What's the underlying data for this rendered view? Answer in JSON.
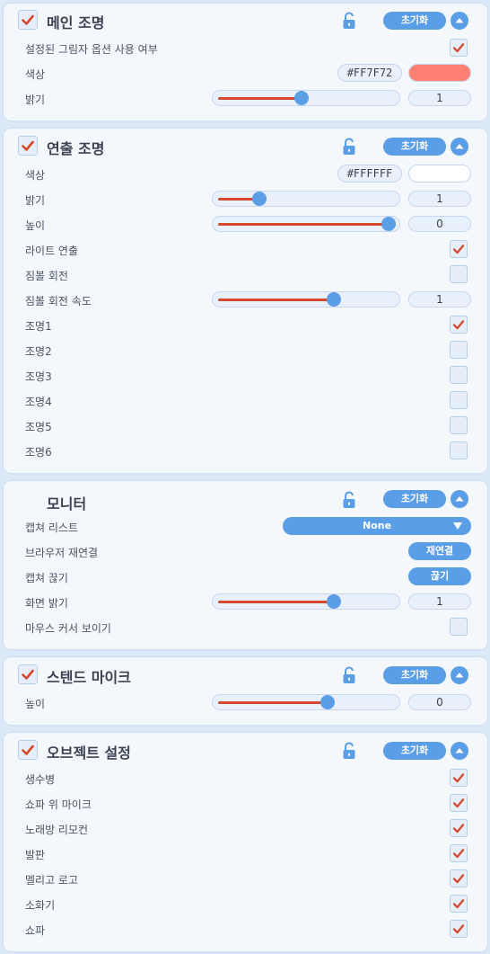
{
  "colors": {
    "accent": "#5b9ee8",
    "check": "#d6492a",
    "slider_fill": "#d6492a"
  },
  "reset_label": "초기화",
  "main_light": {
    "title": "메인 조명",
    "enabled": true,
    "rows": {
      "shadow_label": "설정된 그림자 옵션 사용 여부",
      "shadow_checked": true,
      "color_label": "색상",
      "color_hex": "#FF7F72",
      "color_value": "#FF7F72",
      "brightness_label": "밝기",
      "brightness_value": "1",
      "brightness_level": 0.49
    }
  },
  "effect_light": {
    "title": "연출 조명",
    "enabled": true,
    "rows": {
      "color_label": "색상",
      "color_hex": "#FFFFFF",
      "color_value": "#FFFFFF",
      "brightness_label": "밝기",
      "brightness_value": "1",
      "brightness_level": 0.24,
      "height_label": "높이",
      "height_value": "0",
      "height_level": 1.0,
      "light_effect_label": "라이트 연출",
      "light_effect_checked": true,
      "gimbal_label": "짐볼 회전",
      "gimbal_checked": false,
      "gimbal_speed_label": "짐볼 회전 속도",
      "gimbal_speed_value": "1",
      "gimbal_speed_level": 0.68
    },
    "lights": [
      {
        "label": "조명1",
        "checked": true
      },
      {
        "label": "조명2",
        "checked": false
      },
      {
        "label": "조명3",
        "checked": false
      },
      {
        "label": "조명4",
        "checked": false
      },
      {
        "label": "조명5",
        "checked": false
      },
      {
        "label": "조명6",
        "checked": false
      }
    ]
  },
  "monitor": {
    "title": "모니터",
    "capture_list_label": "캡쳐 리스트",
    "capture_list_value": "None",
    "browser_reconnect_label": "브라우저 재연결",
    "reconnect_button": "재연결",
    "capture_stop_label": "캡쳐 끊기",
    "stop_button": "끊기",
    "screen_brightness_label": "화면 밝기",
    "screen_brightness_value": "1",
    "screen_brightness_level": 0.68,
    "show_cursor_label": "마우스 커서 보이기",
    "show_cursor_checked": false
  },
  "stand_mic": {
    "title": "스텐드 마이크",
    "enabled": true,
    "height_label": "높이",
    "height_value": "0",
    "height_level": 0.64
  },
  "objects": {
    "title": "오브젝트 설정",
    "enabled": true,
    "items": [
      {
        "label": "생수병",
        "checked": true
      },
      {
        "label": "쇼파 위 마이크",
        "checked": true
      },
      {
        "label": "노래방 리모컨",
        "checked": true
      },
      {
        "label": "발판",
        "checked": true
      },
      {
        "label": "멜리고 로고",
        "checked": true
      },
      {
        "label": "소화기",
        "checked": true
      },
      {
        "label": "쇼파",
        "checked": true
      }
    ]
  }
}
